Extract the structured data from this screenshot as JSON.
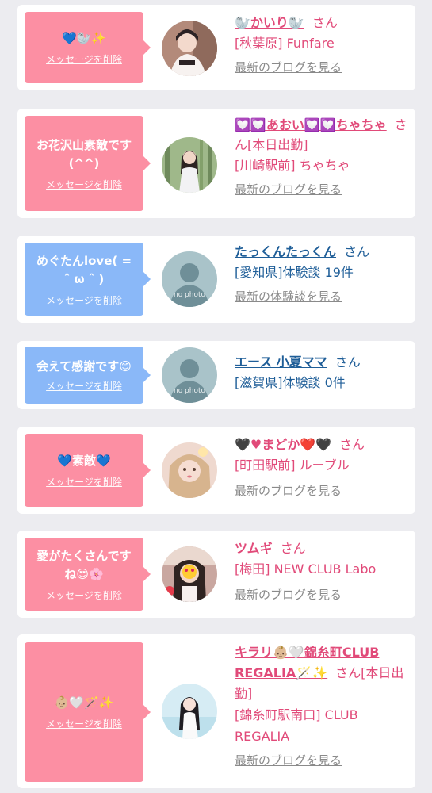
{
  "delete_label": "メッセージを削除",
  "san": "さん",
  "nophoto": "no photo",
  "colors": {
    "pink_bubble": "#fc8fa3",
    "blue_bubble": "#8ab8f8",
    "pink_text": "#e14a79",
    "blue_text": "#1f5e98",
    "link_gray": "#8a8a8a"
  },
  "cards": [
    {
      "message": "💙🦭✨",
      "name": "🦭かいり🦭",
      "shop": "[秋葉原] Funfare",
      "link": "最新のブログを見る"
    },
    {
      "message": "お花沢山素敵です(^^)",
      "name": "💟💟あおい💟💟ちゃちゃ",
      "san_extra": "[本日出勤]",
      "shop": "[川崎駅前] ちゃちゃ",
      "link": "最新のブログを見る"
    },
    {
      "message": "めぐたんlove( = ˆ ω ˆ )",
      "name": "たっくんたっくん",
      "shop": "[愛知県]体験談 19件",
      "link": "最新の体験談を見る"
    },
    {
      "message": "会えて感謝です😊",
      "name": "エース 小夏ママ",
      "shop": "[滋賀県]体験談 0件"
    },
    {
      "message": "💙素敵💙",
      "name": "🖤♥まどか❤️🖤",
      "shop": "[町田駅前] ルーブル",
      "link": "最新のブログを見る"
    },
    {
      "message": "愛がたくさんですね😍🌸",
      "name": "ツムギ",
      "shop": "[梅田] NEW CLUB Labo",
      "link": "最新のブログを見る"
    },
    {
      "message": "👶🏼🤍🪄✨",
      "name": "キラリ👶🏼🤍錦糸町CLUB REGALIA🪄✨",
      "san_extra": "[本日出勤]",
      "shop": "[錦糸町駅南口] CLUB REGALIA",
      "link": "最新のブログを見る"
    }
  ]
}
